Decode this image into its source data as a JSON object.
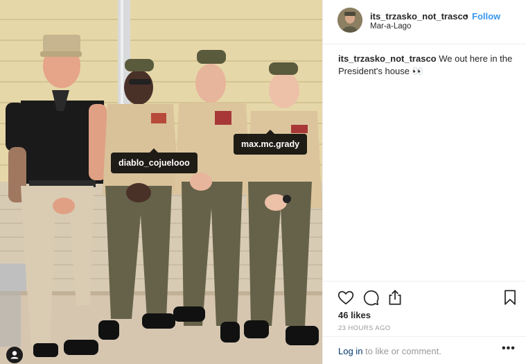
{
  "post": {
    "username": "its_trzasko_not_trasco",
    "separator": "•",
    "follow_label": "Follow",
    "location": "Mar-a-Lago",
    "caption_username": "its_trzasko_not_trasco",
    "caption_text": " We out here in the President's house 👀",
    "likes": "46 likes",
    "timestamp": "23 HOURS AGO",
    "login_link": "Log in",
    "login_rest": " to like or comment.",
    "more_label": "•••"
  },
  "photo": {
    "tags": [
      "diablo_cojuelooo",
      "max.mc.grady"
    ]
  },
  "icons": [
    "heart-icon",
    "comment-icon",
    "share-icon",
    "bookmark-icon",
    "user-tag-icon",
    "more-icon"
  ],
  "colors": {
    "link": "#3897f0",
    "login_link": "#003569",
    "muted": "#999999",
    "text": "#262626"
  }
}
